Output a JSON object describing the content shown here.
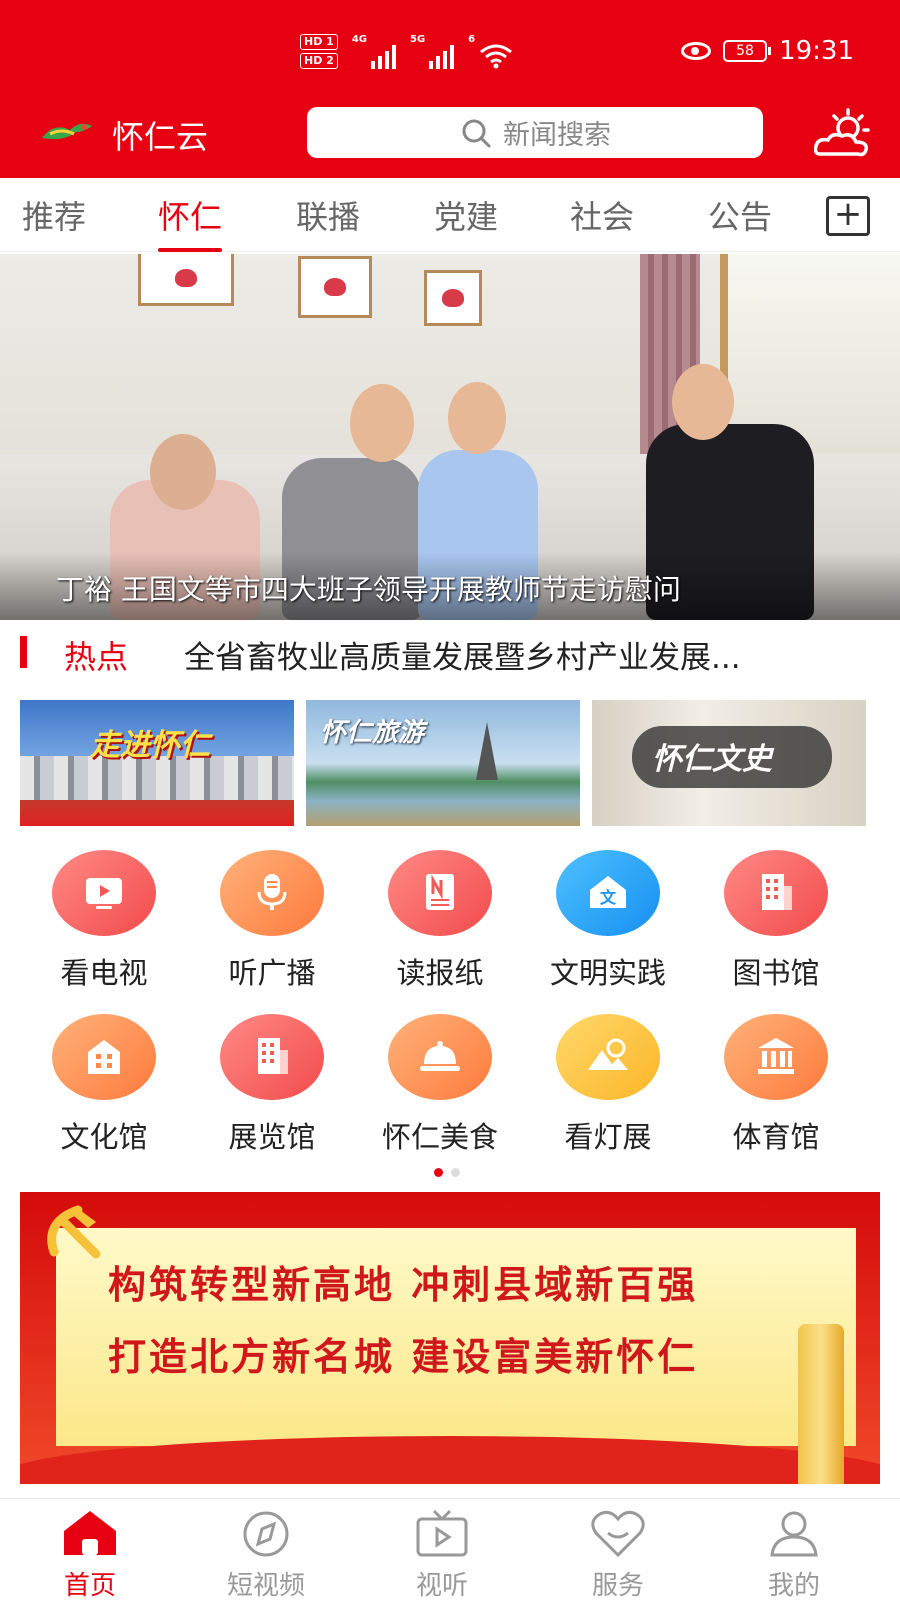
{
  "status_bar": {
    "hd1": "HD 1",
    "hd2": "HD 2",
    "net1": "4G",
    "net2": "5G",
    "wifi": "6",
    "battery": "58",
    "time": "19:31"
  },
  "header": {
    "app_name": "怀仁云",
    "search_placeholder": "新闻搜索",
    "brand_color": "#e60012"
  },
  "tabs": [
    {
      "label": "推荐",
      "active": false
    },
    {
      "label": "怀仁",
      "active": true
    },
    {
      "label": "联播",
      "active": false
    },
    {
      "label": "党建",
      "active": false
    },
    {
      "label": "社会",
      "active": false
    },
    {
      "label": "公告",
      "active": false
    }
  ],
  "banner": {
    "caption": "丁裕 王国文等市四大班子领导开展教师节走访慰问"
  },
  "hot": {
    "label": "热点",
    "text": "全省畜牧业高质量发展暨乡村产业发展..."
  },
  "thumbs": [
    {
      "title": "走进怀仁"
    },
    {
      "title": "怀仁旅游"
    },
    {
      "title": "怀仁文史"
    }
  ],
  "services": [
    {
      "label": "看电视",
      "icon": "tv-icon",
      "color": "red"
    },
    {
      "label": "听广播",
      "icon": "microphone-icon",
      "color": "orange"
    },
    {
      "label": "读报纸",
      "icon": "newspaper-icon",
      "color": "red"
    },
    {
      "label": "文明实践",
      "icon": "civilization-icon",
      "color": "blue"
    },
    {
      "label": "图书馆",
      "icon": "library-building-icon",
      "color": "red"
    },
    {
      "label": "文化馆",
      "icon": "culture-house-icon",
      "color": "orange"
    },
    {
      "label": "展览馆",
      "icon": "exhibition-building-icon",
      "color": "red"
    },
    {
      "label": "怀仁美食",
      "icon": "food-dish-icon",
      "color": "orange"
    },
    {
      "label": "看灯展",
      "icon": "lantern-landscape-icon",
      "color": "yellow"
    },
    {
      "label": "体育馆",
      "icon": "stadium-icon",
      "color": "orange"
    }
  ],
  "pager": {
    "pages": 2,
    "current": 1
  },
  "slogan": {
    "line1": "构筑转型新高地  冲刺县域新百强",
    "line2": "打造北方新名城  建设富美新怀仁"
  },
  "nav": [
    {
      "label": "首页",
      "icon": "home-icon",
      "active": true
    },
    {
      "label": "短视频",
      "icon": "compass-icon",
      "active": false
    },
    {
      "label": "视听",
      "icon": "tv-play-icon",
      "active": false
    },
    {
      "label": "服务",
      "icon": "heart-icon",
      "active": false
    },
    {
      "label": "我的",
      "icon": "user-icon",
      "active": false
    }
  ]
}
